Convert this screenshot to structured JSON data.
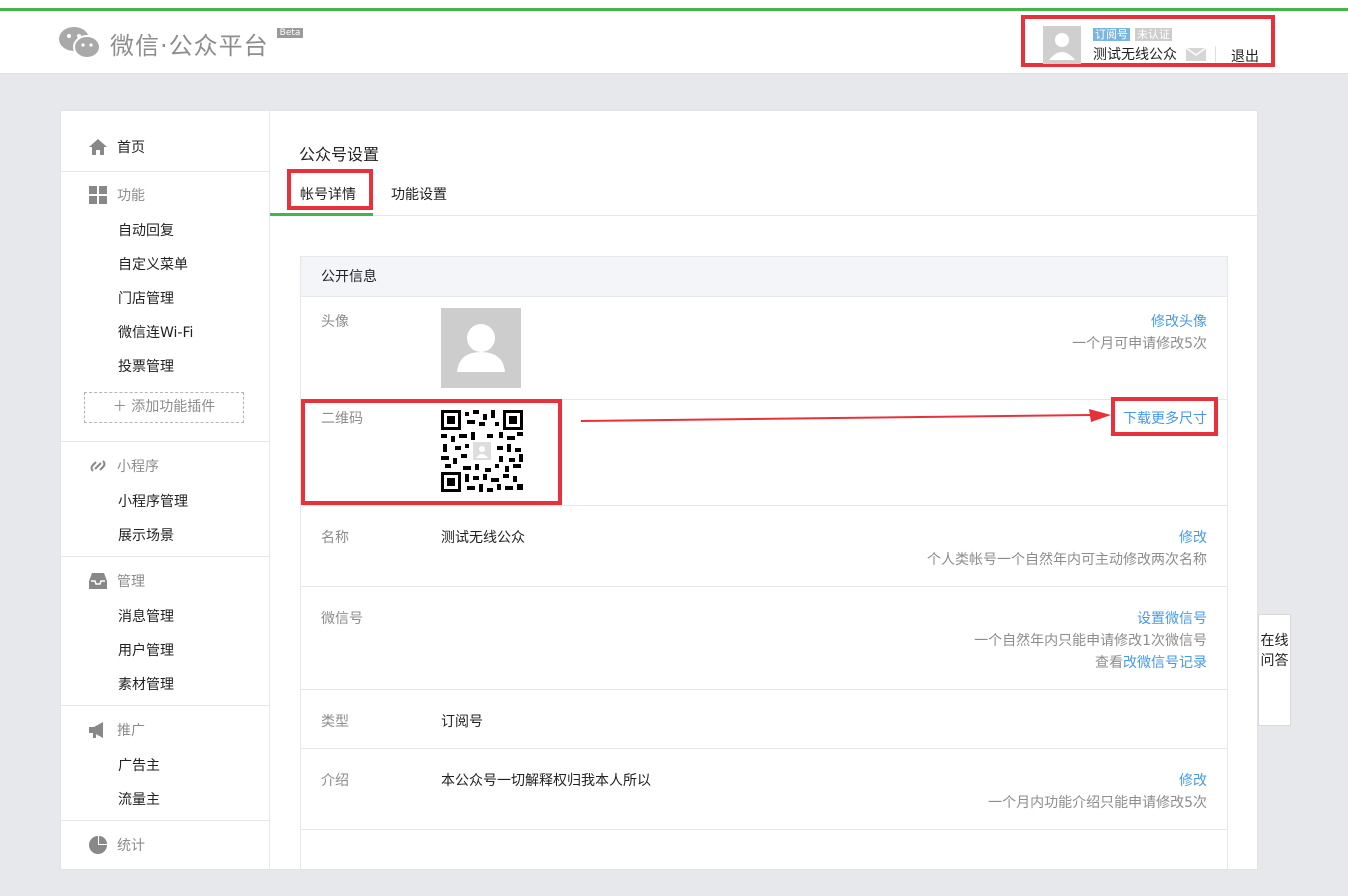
{
  "header": {
    "logo_text": "微信·公众平台",
    "beta": "Beta",
    "account": {
      "tag_type": "订阅号",
      "tag_status": "未认证",
      "name": "测试无线公众",
      "logout": "退出"
    }
  },
  "sidebar": {
    "home": "首页",
    "groups": [
      {
        "title": "功能",
        "icon": "grid-icon",
        "items": [
          "自动回复",
          "自定义菜单",
          "门店管理",
          "微信连Wi-Fi",
          "投票管理"
        ]
      },
      {
        "title": "小程序",
        "icon": "link-icon",
        "items": [
          "小程序管理",
          "展示场景"
        ]
      },
      {
        "title": "管理",
        "icon": "inbox-icon",
        "items": [
          "消息管理",
          "用户管理",
          "素材管理"
        ]
      },
      {
        "title": "推广",
        "icon": "megaphone-icon",
        "items": [
          "广告主",
          "流量主"
        ]
      },
      {
        "title": "统计",
        "icon": "pie-icon",
        "items": []
      }
    ],
    "add_plugin": "添加功能插件"
  },
  "main": {
    "title": "公众号设置",
    "tabs": [
      "帐号详情",
      "功能设置"
    ],
    "panel_title": "公开信息",
    "rows": {
      "avatar": {
        "label": "头像",
        "link": "修改头像",
        "tip": "一个月可申请修改5次"
      },
      "qrcode": {
        "label": "二维码",
        "link": "下载更多尺寸"
      },
      "name": {
        "label": "名称",
        "value": "测试无线公众",
        "link": "修改",
        "tip": "个人类帐号一个自然年内可主动修改两次名称"
      },
      "wechat_id": {
        "label": "微信号",
        "link": "设置微信号",
        "tip": "一个自然年内只能申请修改1次微信号",
        "tip2_prefix": "查看",
        "tip2_link": "改微信号记录"
      },
      "type": {
        "label": "类型",
        "value": "订阅号"
      },
      "intro": {
        "label": "介绍",
        "value": "本公众号一切解释权归我本人所以",
        "link": "修改",
        "tip": "一个月内功能介绍只能申请修改5次"
      }
    }
  },
  "online_help": "在线问答",
  "colors": {
    "accent": "#44b549",
    "link": "#459ae9",
    "highlight": "#e8323b"
  }
}
